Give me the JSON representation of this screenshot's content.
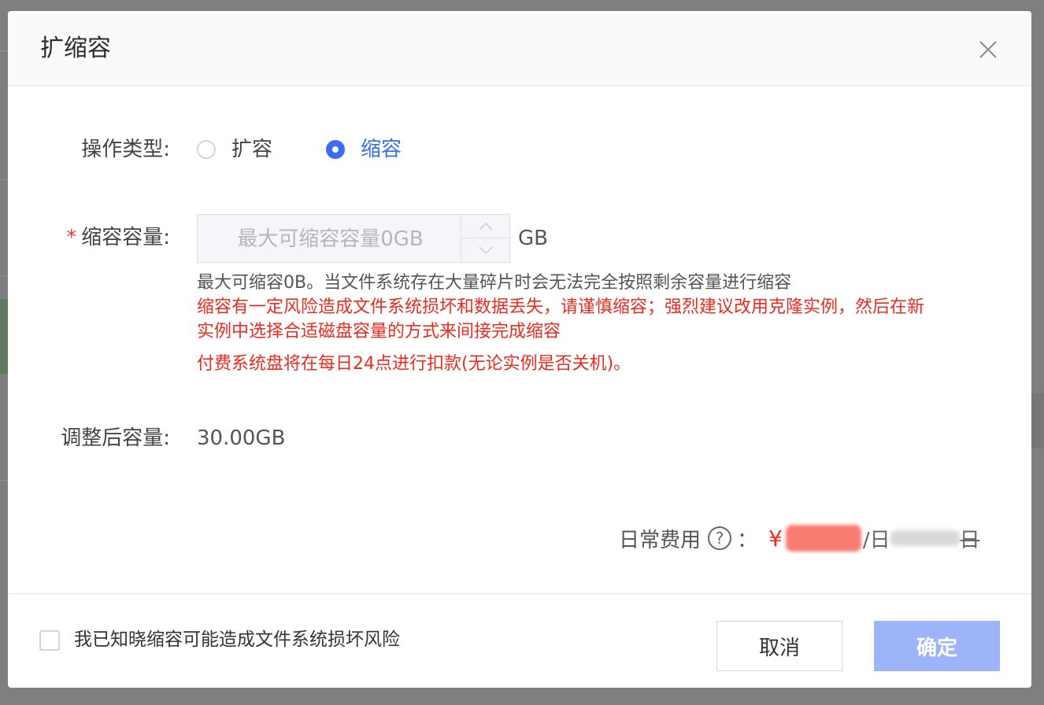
{
  "dialog": {
    "title": "扩缩容",
    "close_icon": "close-icon"
  },
  "form": {
    "operation_type": {
      "label": "操作类型:",
      "options": [
        {
          "label": "扩容",
          "selected": false
        },
        {
          "label": "缩容",
          "selected": true
        }
      ]
    },
    "shrink_capacity": {
      "label": "缩容容量:",
      "required_mark": "*",
      "placeholder": "最大可缩容容量0GB",
      "value": "",
      "unit": "GB",
      "hint": "最大可缩容0B。当文件系统存在大量碎片时会无法完全按照剩余容量进行缩容",
      "warning_line1": "缩容有一定风险造成文件系统损坏和数据丢失，请谨慎缩容；强烈建议改用克隆实例，然后在新",
      "warning_line2": "实例中选择合适磁盘容量的方式来间接完成缩容",
      "billing_notice": "付费系统盘将在每日24点进行扣款(无论实例是否关机)。"
    },
    "adjusted_capacity": {
      "label": "调整后容量:",
      "value": "30.00GB"
    }
  },
  "fee": {
    "label": "日常费用",
    "colon": "：",
    "currency": "¥",
    "unit": "/日",
    "old_unit": "日"
  },
  "footer": {
    "acknowledge_label": "我已知晓缩容可能造成文件系统损坏风险",
    "acknowledge_checked": false,
    "cancel_label": "取消",
    "confirm_label": "确定"
  },
  "colors": {
    "primary": "#3b6df0",
    "danger": "#f02a1f",
    "confirm_disabled": "#9db3fa"
  }
}
